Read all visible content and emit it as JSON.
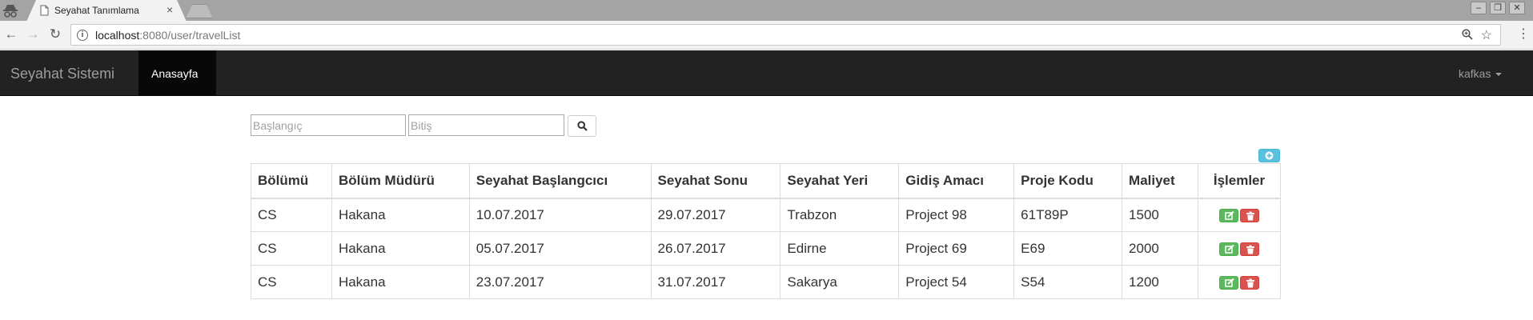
{
  "browser": {
    "tab_title": "Seyahat Tanımlama",
    "close_glyph": "×",
    "url_host": "localhost",
    "url_rest": ":8080/user/travelList",
    "icons": [
      "incognito-icon",
      "page-icon",
      "back-icon",
      "forward-icon",
      "reload-icon",
      "info-icon",
      "zoom-icon",
      "star-icon",
      "menu-icon"
    ]
  },
  "navbar": {
    "brand": "Seyahat Sistemi",
    "active_item": "Anasayfa",
    "user": "kafkas",
    "bg_color": "#222222"
  },
  "filter": {
    "start_placeholder": "Başlangıç",
    "end_placeholder": "Bitiş",
    "search_icon": "search-icon",
    "add_icon": "plus-circle-icon"
  },
  "table": {
    "headers": [
      "Bölümü",
      "Bölüm Müdürü",
      "Seyahat Başlangcıcı",
      "Seyahat Sonu",
      "Seyahat Yeri",
      "Gidiş Amacı",
      "Proje Kodu",
      "Maliyet",
      "İşlemler"
    ],
    "rows": [
      [
        "CS",
        "Hakana",
        "10.07.2017",
        "29.07.2017",
        "Trabzon",
        "Project 98",
        "61T89P",
        "1500"
      ],
      [
        "CS",
        "Hakana",
        "05.07.2017",
        "26.07.2017",
        "Edirne",
        "Project 69",
        "E69",
        "2000"
      ],
      [
        "CS",
        "Hakana",
        "23.07.2017",
        "31.07.2017",
        "Sakarya",
        "Project 54",
        "S54",
        "1200"
      ]
    ],
    "edit_color": "#5cb85c",
    "delete_color": "#d9534f"
  }
}
